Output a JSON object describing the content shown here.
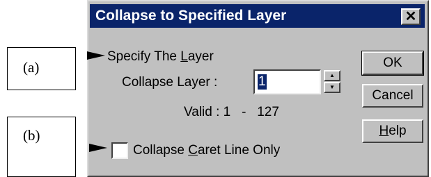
{
  "callouts": {
    "a": "(a)",
    "b": "(b)"
  },
  "dialog": {
    "title": "Collapse to Specified Layer",
    "close_glyph": "✕",
    "group_label": {
      "pre": "Specify The ",
      "u": "L",
      "post": "ayer"
    },
    "collapse_layer_label": "Collapse Layer :",
    "collapse_layer_value": "1",
    "spin_up": "▲",
    "spin_down": "▼",
    "valid_label": "Valid : 1   -   127",
    "checkbox_label": {
      "pre": "Collapse ",
      "u": "C",
      "post": "aret Line Only"
    },
    "checkbox_checked": false,
    "buttons": {
      "ok": "OK",
      "cancel": "Cancel",
      "help": {
        "u": "H",
        "post": "elp"
      }
    }
  }
}
